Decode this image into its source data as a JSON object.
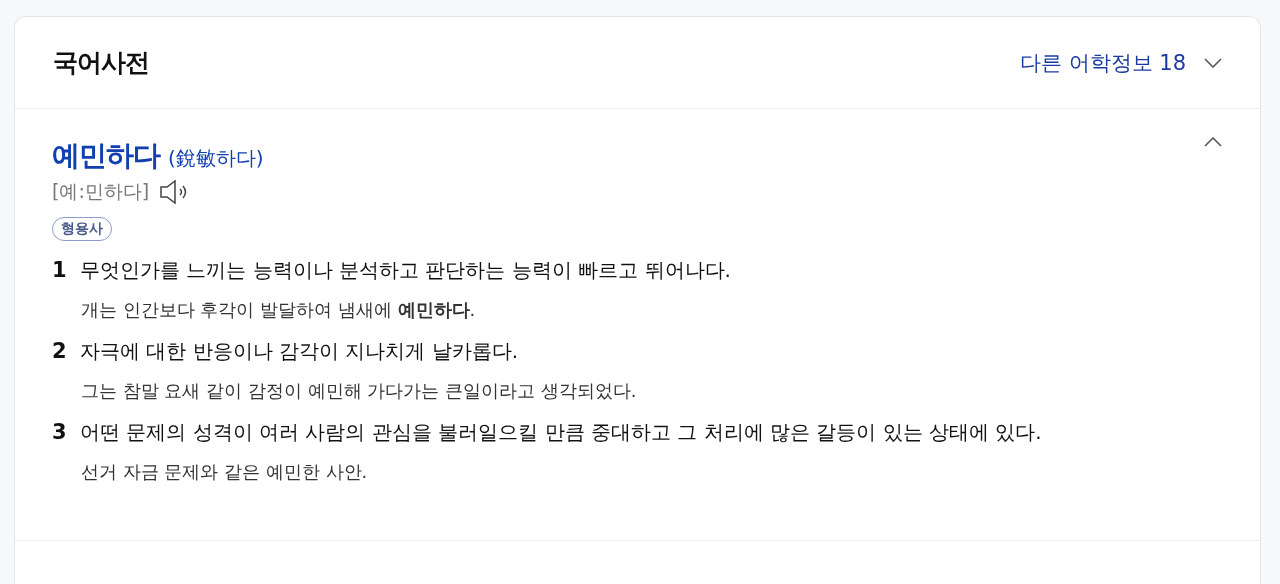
{
  "header": {
    "title": "국어사전",
    "more_link": "다른 어학정보 18",
    "expanded": false
  },
  "entry": {
    "word": "예민하다",
    "hanja": "(銳敏하다)",
    "pronunciation": "[예:민하다]",
    "pos": "형용사",
    "expanded": true,
    "senses": [
      {
        "number": "1",
        "definition": "무엇인가를 느끼는 능력이나 분석하고 판단하는 능력이 빠르고 뛰어나다.",
        "example": "개는 인간보다 후각이 발달하여 냄새에 **예민하다**."
      },
      {
        "number": "2",
        "definition": "자극에 대한 반응이나 감각이 지나치게 날카롭다.",
        "example": "그는 참말 요새 같이 감정이 예민해 가다가는 큰일이라고 생각되었다."
      },
      {
        "number": "3",
        "definition": "어떤 문제의 성격이 여러 사람의 관심을 불러일으킬 만큼 중대하고 그 처리에 많은 갈등이 있는 상태에 있다.",
        "example": "선거 자금 문제와 같은 예민한 사안."
      }
    ]
  }
}
